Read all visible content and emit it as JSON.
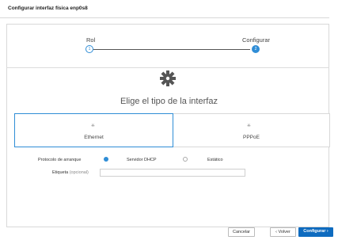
{
  "dialog": {
    "title": "Configurar interfaz física enp0s8"
  },
  "wizard": {
    "steps": [
      {
        "label": "Rol",
        "number": "1"
      },
      {
        "label": "Configurar",
        "number": "2"
      }
    ],
    "heading": "Elige el tipo de la interfaz"
  },
  "types": [
    {
      "label": "Ethernet",
      "icon": "network-icon",
      "selected": true
    },
    {
      "label": "PPPoE",
      "icon": "network-icon",
      "selected": false
    }
  ],
  "form": {
    "boot_protocol_label": "Protocolo de arranque",
    "options": [
      {
        "label": "Servidor DHCP",
        "selected": true
      },
      {
        "label": "Estático",
        "selected": false
      }
    ],
    "tag_label": "Etiqueta",
    "tag_optional": "(opcional)",
    "tag_value": ""
  },
  "buttons": {
    "cancel": "Cancelar",
    "back": "‹ Volver",
    "configure": "Configurar ›"
  },
  "colors": {
    "accent": "#2f8dd6",
    "primary_button": "#0e6bbf"
  }
}
